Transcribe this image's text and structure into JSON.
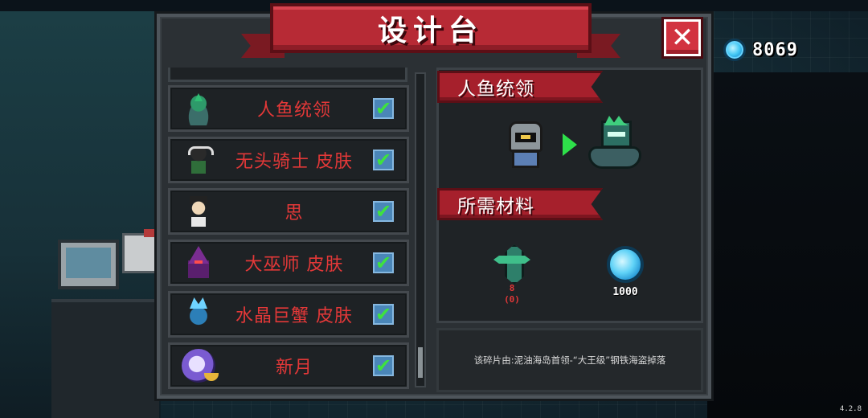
{
  "title": "设计台",
  "currency": {
    "value": "8069",
    "icon": "blue-gem-icon",
    "color": "#43c7f4"
  },
  "list": {
    "items": [
      {
        "label": "人鱼统领",
        "icon": "merfolk-leader-icon",
        "checked": true
      },
      {
        "label": "无头骑士 皮肤",
        "icon": "headless-knight-icon",
        "checked": true
      },
      {
        "label": "思",
        "icon": "si-character-icon",
        "checked": true
      },
      {
        "label": "大巫师 皮肤",
        "icon": "archmage-icon",
        "checked": true
      },
      {
        "label": "水晶巨蟹 皮肤",
        "icon": "crystal-crab-icon",
        "checked": true
      },
      {
        "label": "新月",
        "icon": "crescent-moon-icon",
        "checked": true
      }
    ],
    "check_glyph": "✔",
    "label_color": "#e33838"
  },
  "detail": {
    "name_ribbon": "人鱼统领",
    "materials_ribbon": "所需材料",
    "materials": [
      {
        "icon": "merfolk-fragment-icon",
        "count": "8",
        "owned": "(0)"
      },
      {
        "icon": "blue-gem-icon",
        "count": "1000"
      }
    ],
    "description": "该碎片由:泥油海岛首领-“大王级”钢铁海盗掉落"
  },
  "close_glyph": "✕",
  "version": "4.2.8",
  "accent_red": "#b72a35"
}
